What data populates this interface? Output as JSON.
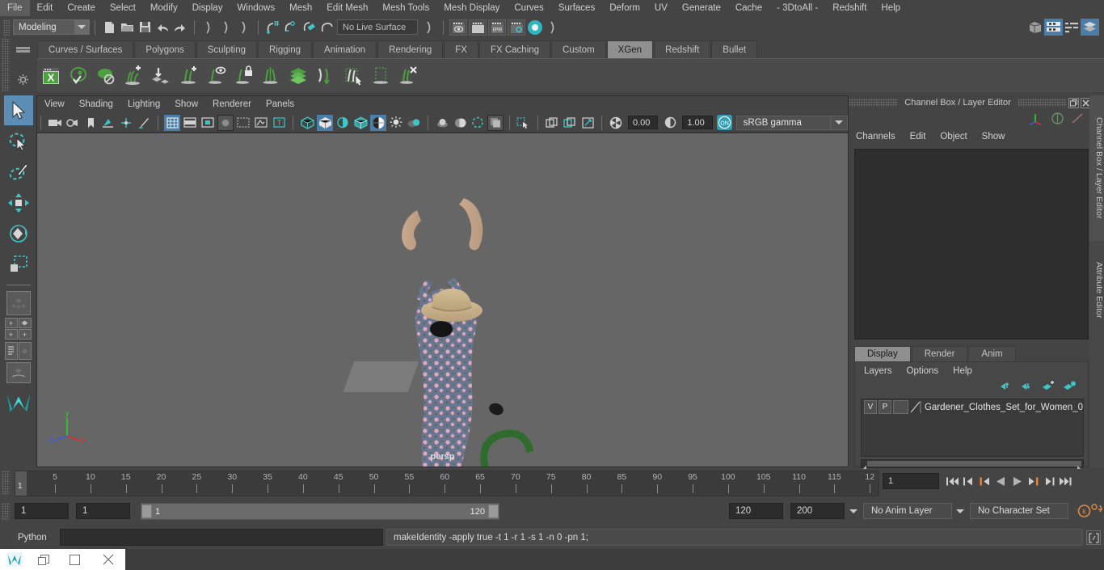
{
  "menubar": {
    "items": [
      "File",
      "Edit",
      "Create",
      "Select",
      "Modify",
      "Display",
      "Windows",
      "Mesh",
      "Edit Mesh",
      "Mesh Tools",
      "Mesh Display",
      "Curves",
      "Surfaces",
      "Deform",
      "UV",
      "Generate",
      "Cache",
      "- 3DtoAll -",
      "Redshift",
      "Help"
    ]
  },
  "statusline": {
    "mode": "Modeling",
    "live_surface": "No Live Surface",
    "icons": [
      "new-scene-icon",
      "open-scene-icon",
      "save-scene-icon",
      "undo-icon",
      "redo-icon",
      "select-by-hierarchy-icon",
      "select-by-object-icon",
      "select-by-component-icon",
      "snap-to-grid-icon",
      "snap-to-curve-icon",
      "snap-to-point-icon",
      "snap-to-projected-center-icon",
      "render-view-icon",
      "render-region-icon",
      "ipr-render-icon",
      "render-settings-icon",
      "hypershade-icon"
    ],
    "right_icons": [
      "sidebar-toggle-icon",
      "attribute-editor-icon",
      "tool-settings-icon",
      "channel-box-icon"
    ]
  },
  "shelf": {
    "tabs": [
      "Curves / Surfaces",
      "Polygons",
      "Sculpting",
      "Rigging",
      "Animation",
      "Rendering",
      "FX",
      "FX Caching",
      "Custom",
      "XGen",
      "Redshift",
      "Bullet"
    ],
    "active_tab": "XGen",
    "icons": [
      "xgen-editor-icon",
      "xgen-preview-icon",
      "xgen-disable-preview-icon",
      "add-description-icon",
      "import-collection-icon",
      "add-guide-icon",
      "guide-visibility-icon",
      "lock-guide-icon",
      "mirror-guide-icon",
      "export-patches-icon",
      "convert-to-curves-icon",
      "select-guides-icon",
      "region-select-icon",
      "delete-guides-icon"
    ]
  },
  "toolbox": {
    "tools": [
      "select-tool",
      "lasso-select-tool",
      "paint-select-tool",
      "move-tool",
      "rotate-tool",
      "scale-tool"
    ],
    "layouts": [
      "single-perspective-layout",
      "four-view-layout",
      "outliner-persp-layout",
      "hypergraph-persp-layout"
    ],
    "logo": "maya-logo"
  },
  "viewport": {
    "menus": [
      "View",
      "Shading",
      "Lighting",
      "Show",
      "Renderer",
      "Panels"
    ],
    "camera_label": "persp",
    "exposure": "0.00",
    "gamma": "1.00",
    "color_mode": "sRGB gamma",
    "view_toggle": "ON",
    "axis": {
      "x": "x",
      "y": "y",
      "z": "z"
    },
    "scene": "gardener-clothes-set-for-women"
  },
  "channel_box": {
    "title": "Channel Box / Layer Editor",
    "menus": [
      "Channels",
      "Edit",
      "Object",
      "Show"
    ],
    "window_buttons": [
      "undock-icon",
      "close-icon"
    ]
  },
  "layer_editor": {
    "tabs": [
      "Display",
      "Render",
      "Anim"
    ],
    "active_tab": "Display",
    "menus": [
      "Layers",
      "Options",
      "Help"
    ],
    "toolbar_icons": [
      "move-layer-up-icon",
      "move-layer-down-icon",
      "new-layer-from-selected-icon",
      "new-layer-icon"
    ],
    "rows": [
      {
        "visibility": "V",
        "playback": "P",
        "color": "",
        "name": "Gardener_Clothes_Set_for_Women_0"
      }
    ]
  },
  "right_strip": {
    "tabs": [
      "Channel Box / Layer Editor",
      "Attribute Editor"
    ]
  },
  "timeline": {
    "current_frame": "1",
    "ticks": [
      "5",
      "10",
      "15",
      "20",
      "25",
      "30",
      "35",
      "40",
      "45",
      "50",
      "55",
      "60",
      "65",
      "70",
      "75",
      "80",
      "85",
      "90",
      "95",
      "100",
      "105",
      "110",
      "115",
      "12"
    ],
    "playback_buttons": [
      "go-to-start-icon",
      "step-back-frame-icon",
      "step-back-key-icon",
      "play-backwards-icon",
      "play-forwards-icon",
      "step-forward-key-icon",
      "step-forward-frame-icon",
      "go-to-end-icon"
    ]
  },
  "range_slider": {
    "anim_start": "1",
    "playback_start": "1",
    "range_start_value": "1",
    "range_end_value": "120",
    "playback_end": "120",
    "anim_end": "200",
    "anim_layer": "No Anim Layer",
    "character_set": "No Character Set",
    "right_icons": [
      "auto-keyframe-icon",
      "animation-preferences-icon"
    ]
  },
  "command_line": {
    "language": "Python",
    "input_value": "",
    "output": "makeIdentity -apply true -t 1 -r 1 -s 1 -n 0 -pn 1;",
    "script_editor_icon": "script-editor-icon"
  },
  "taskbar": {
    "icons": [
      "maya-app-icon",
      "restore-window-icon",
      "maximize-window-icon",
      "close-window-icon"
    ]
  },
  "colors": {
    "accent_blue": "#4a7ea8",
    "accent_teal": "#3ec6c6",
    "xgen_green": "#63a84f",
    "orange": "#d98b45",
    "panel_bg": "#444444",
    "viewport_bg": "#666666"
  }
}
